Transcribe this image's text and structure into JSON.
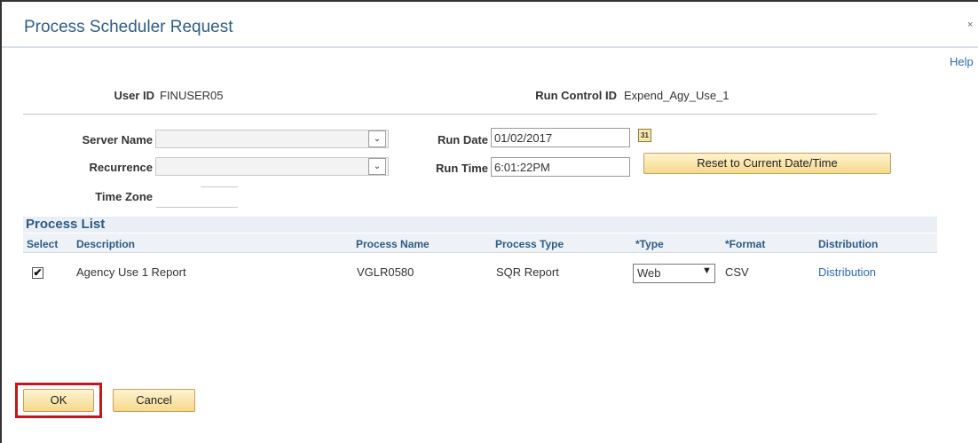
{
  "window": {
    "title": "Process Scheduler Request",
    "close_glyph": "×",
    "help_label": "Help"
  },
  "ids": {
    "user_id_label": "User ID",
    "user_id_value": "FINUSER05",
    "run_control_label": "Run Control ID",
    "run_control_value": "Expend_Agy_Use_1"
  },
  "form": {
    "server_name_label": "Server Name",
    "server_name_value": "",
    "recurrence_label": "Recurrence",
    "recurrence_value": "",
    "time_zone_label": "Time Zone",
    "run_date_label": "Run Date",
    "run_date_value": "01/02/2017",
    "run_time_label": "Run Time",
    "run_time_value": "6:01:22PM",
    "reset_label": "Reset to Current Date/Time",
    "calendar_glyph": "31",
    "dropdown_glyph": "⌄"
  },
  "process_list": {
    "title": "Process List",
    "columns": {
      "select": "Select",
      "description": "Description",
      "process_name": "Process Name",
      "process_type": "Process Type",
      "type": "*Type",
      "format": "*Format",
      "distribution": "Distribution"
    },
    "rows": [
      {
        "checked": "✔",
        "description": "Agency Use 1 Report",
        "process_name": "VGLR0580",
        "process_type": "SQR Report",
        "type": "Web",
        "type_arrow": "▼",
        "format": "CSV",
        "distribution": "Distribution"
      }
    ]
  },
  "actions": {
    "ok_label": "OK",
    "cancel_label": "Cancel"
  },
  "colors": {
    "title": "#2f5d8c",
    "link": "#2a6ab2",
    "highlight": "#c4161c",
    "button_top": "#fff3cf",
    "button_bottom": "#f6d98c"
  },
  "icons": {
    "close": "close-icon",
    "calendar": "calendar-icon",
    "dropdown": "chevron-down-icon",
    "checkbox": "checkbox-checked-icon"
  }
}
